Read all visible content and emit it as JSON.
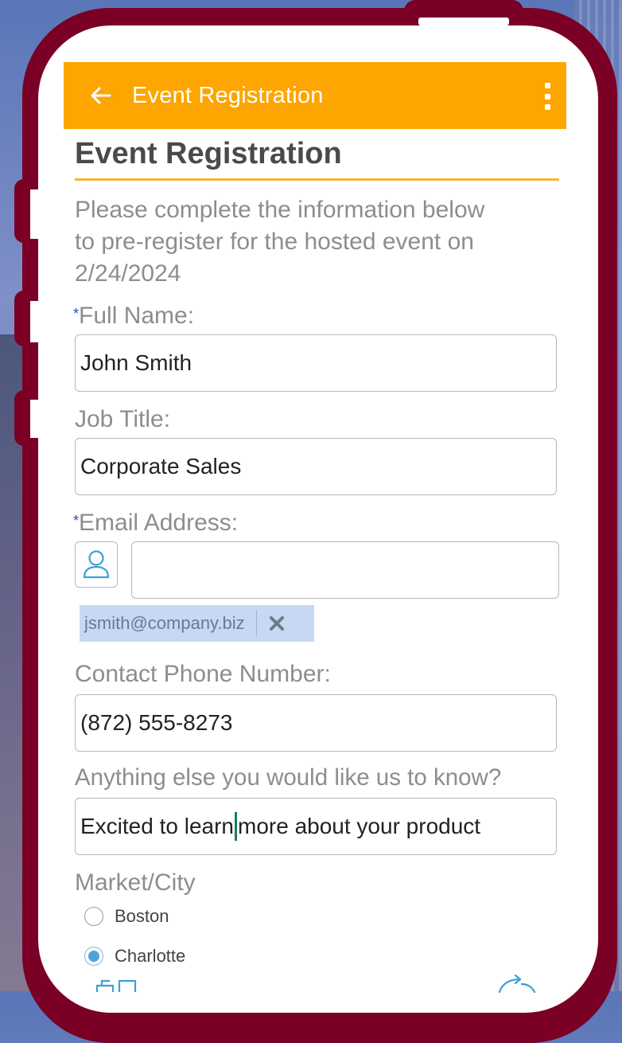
{
  "app_bar": {
    "title": "Event Registration",
    "back_icon": "back-arrow-icon",
    "menu_icon": "more-vert-icon",
    "color": "#fda500"
  },
  "page": {
    "title": "Event Registration",
    "intro_line1": "Please complete the information below",
    "intro_line2": "to pre-register for the hosted event on",
    "intro_line3": "2/24/2024"
  },
  "form": {
    "required_marker": "*",
    "full_name": {
      "label": "Full Name:",
      "value": "John Smith"
    },
    "job_title": {
      "label": "Job Title:",
      "value": "Corporate Sales"
    },
    "email": {
      "label": "Email Address:",
      "value": "",
      "chip": "jsmith@company.biz",
      "picker_icon": "person-icon",
      "remove_icon": "close-icon"
    },
    "phone": {
      "label": "Contact Phone Number:",
      "value": "(872) 555-8273"
    },
    "notes": {
      "label": "Anything else you would like us to know?",
      "value_before_cursor": "Excited to learn",
      "value_after_cursor": "more about your product"
    },
    "market": {
      "label": "Market/City",
      "options": [
        {
          "label": "Boston",
          "selected": false
        },
        {
          "label": "Charlotte",
          "selected": true
        }
      ]
    }
  },
  "colors": {
    "frame": "#7a0026",
    "accent_rule": "#f6b23a",
    "required": "#2846c8",
    "chip_bg": "#c6d8f4"
  }
}
